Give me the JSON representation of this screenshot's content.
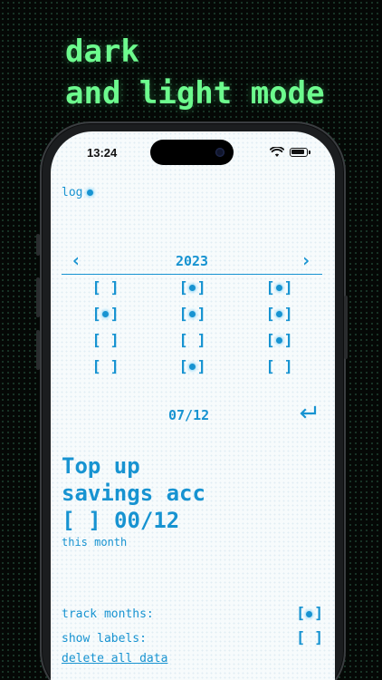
{
  "promo": {
    "line1": "dark",
    "line2": "and light mode"
  },
  "status_bar": {
    "time": "13:24"
  },
  "app": {
    "log_label": "log",
    "year": "2023",
    "months": [
      {
        "checked": false
      },
      {
        "checked": true
      },
      {
        "checked": true
      },
      {
        "checked": true
      },
      {
        "checked": true
      },
      {
        "checked": true
      },
      {
        "checked": false
      },
      {
        "checked": false
      },
      {
        "checked": true
      },
      {
        "checked": false
      },
      {
        "checked": true
      },
      {
        "checked": false
      }
    ],
    "selected_date": "07/12",
    "goal": {
      "title_line1": "Top up",
      "title_line2": "savings acc",
      "checked": false,
      "progress": "00/12",
      "period": "this month"
    },
    "settings": {
      "track_months_label": "track months:",
      "track_months_on": true,
      "show_labels_label": "show labels:",
      "show_labels_on": false,
      "delete_label": "delete all data"
    }
  },
  "colors": {
    "promo_green": "#6dfb8e",
    "accent": "#1793d1",
    "screen_bg": "#f7fbfc",
    "page_bg": "#050806"
  },
  "icons": {
    "prev": "chevron-left-icon",
    "next": "chevron-right-icon",
    "return": "return-arrow-icon",
    "wifi": "wifi-icon",
    "battery": "battery-icon"
  }
}
